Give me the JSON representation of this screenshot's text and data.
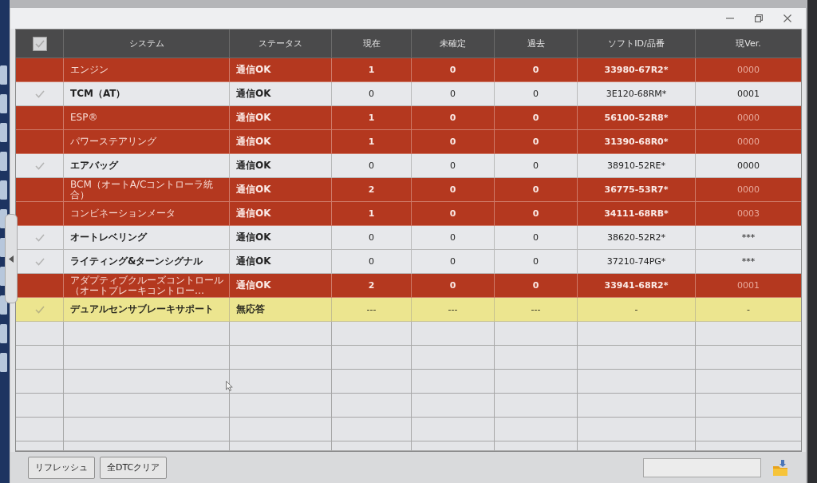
{
  "table": {
    "select_all": {
      "checked": true
    },
    "columns": [
      "システム",
      "ステータス",
      "現在",
      "未確定",
      "過去",
      "ソフトID/品番",
      "現Ver."
    ],
    "rows": [
      {
        "kind": "dtc",
        "checked": false,
        "cells": [
          "エンジン",
          "通信OK",
          "1",
          "0",
          "0",
          "33980-67R2*",
          "0000"
        ]
      },
      {
        "kind": "ok",
        "checked": true,
        "cells": [
          "TCM（AT）",
          "通信OK",
          "0",
          "0",
          "0",
          "3E120-68RM*",
          "0001"
        ]
      },
      {
        "kind": "dtc",
        "checked": false,
        "cells": [
          "ESP®",
          "通信OK",
          "1",
          "0",
          "0",
          "56100-52R8*",
          "0000"
        ]
      },
      {
        "kind": "dtc",
        "checked": false,
        "cells": [
          "パワーステアリング",
          "通信OK",
          "1",
          "0",
          "0",
          "31390-68R0*",
          "0000"
        ]
      },
      {
        "kind": "ok",
        "checked": true,
        "cells": [
          "エアバッグ",
          "通信OK",
          "0",
          "0",
          "0",
          "38910-52RE*",
          "0000"
        ]
      },
      {
        "kind": "dtc",
        "checked": false,
        "cells": [
          "BCM（オートA/Cコントローラ統合）",
          "通信OK",
          "2",
          "0",
          "0",
          "36775-53R7*",
          "0000"
        ]
      },
      {
        "kind": "dtc",
        "checked": false,
        "cells": [
          "コンビネーションメータ",
          "通信OK",
          "1",
          "0",
          "0",
          "34111-68RB*",
          "0003"
        ]
      },
      {
        "kind": "ok",
        "checked": true,
        "cells": [
          "オートレベリング",
          "通信OK",
          "0",
          "0",
          "0",
          "38620-52R2*",
          "***"
        ]
      },
      {
        "kind": "ok",
        "checked": true,
        "cells": [
          "ライティング&ターンシグナル",
          "通信OK",
          "0",
          "0",
          "0",
          "37210-74PG*",
          "***"
        ]
      },
      {
        "kind": "dtc",
        "checked": false,
        "cells": [
          "アダプティブクルーズコントロール（オートブレーキコントロー…",
          "通信OK",
          "2",
          "0",
          "0",
          "33941-68R2*",
          "0001"
        ]
      },
      {
        "kind": "no_response",
        "checked": true,
        "cells": [
          "デュアルセンサブレーキサポート",
          "無応答",
          "---",
          "---",
          "---",
          "-",
          "-"
        ]
      }
    ]
  },
  "buttons": [
    {
      "label": "リフレッシュ"
    },
    {
      "label": "全DTCクリア"
    }
  ]
}
